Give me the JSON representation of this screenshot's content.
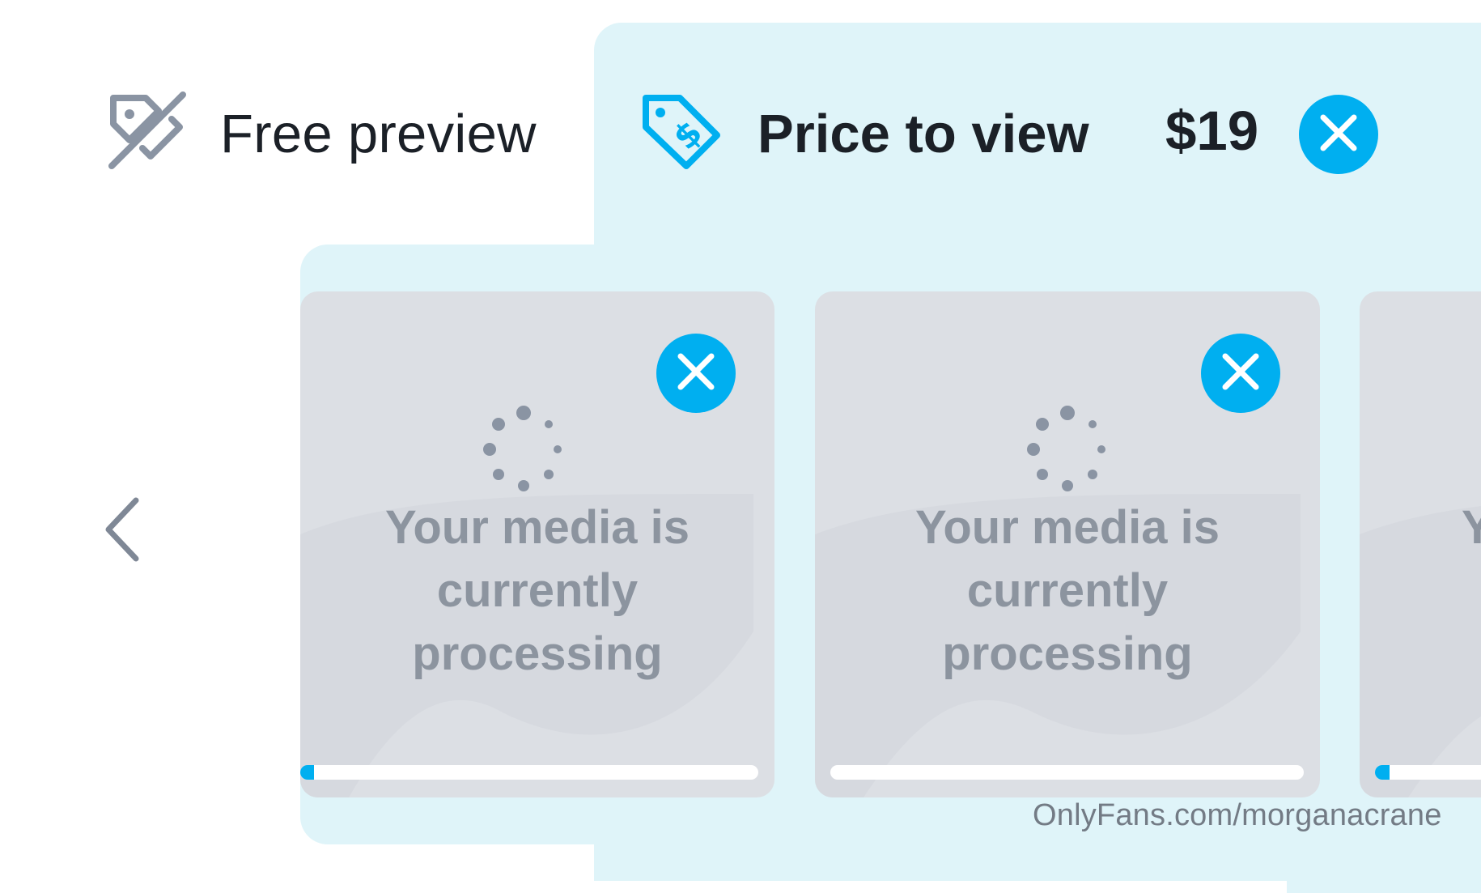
{
  "tabs": {
    "free_preview": {
      "label": "Free preview",
      "icon": "tag-off-icon"
    },
    "price_to_view": {
      "label": "Price to view",
      "icon": "price-tag-dollar-icon",
      "value": "$19"
    }
  },
  "media_cards": [
    {
      "message_lines": [
        "Your media is",
        "currently",
        "processing"
      ],
      "progress": 0.03
    },
    {
      "message_lines": [
        "Your media is",
        "currently",
        "processing"
      ],
      "progress": 0.0
    },
    {
      "message_lines": [
        "Y",
        "",
        ""
      ],
      "progress": 0.03
    }
  ],
  "watermark": "OnlyFans.com/morganacrane",
  "colors": {
    "accent": "#00aff0",
    "panel": "#dff4f9",
    "card": "#dcdfe4",
    "text_dark": "#1b2027",
    "text_muted": "#8c949f",
    "icon_gray": "#8a94a3"
  }
}
